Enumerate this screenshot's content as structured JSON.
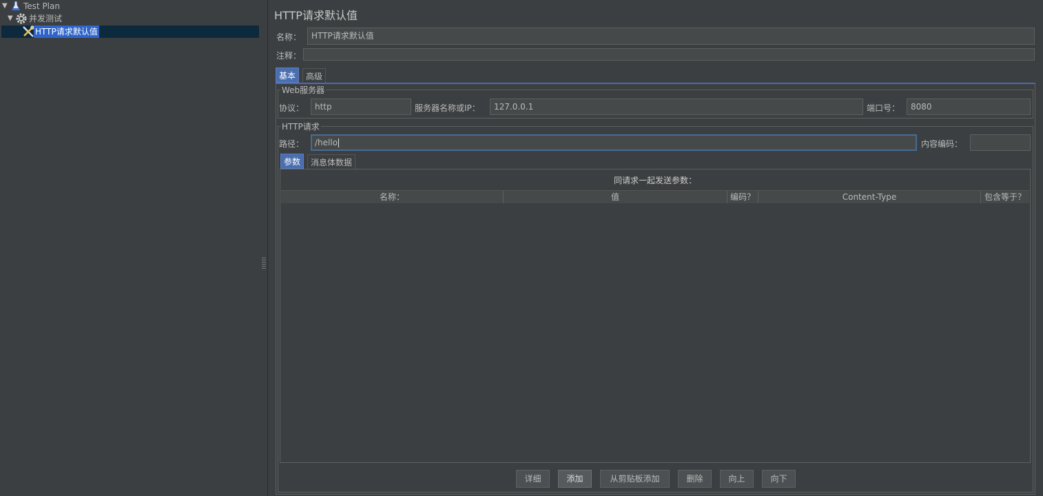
{
  "tree": {
    "items": [
      {
        "label": "Test Plan",
        "icon": "flask-icon",
        "expanded": true
      },
      {
        "label": "并发测试",
        "icon": "gear-icon",
        "expanded": true
      },
      {
        "label": "HTTP请求默认值",
        "icon": "tools-icon",
        "selected": true
      }
    ]
  },
  "panel": {
    "title": "HTTP请求默认值",
    "name_label": "名称：",
    "name_value": "HTTP请求默认值",
    "comment_label": "注释：",
    "comment_value": ""
  },
  "tabs": {
    "basic": "基本",
    "advanced": "高级"
  },
  "web_server": {
    "group_title": "Web服务器",
    "protocol_label": "协议：",
    "protocol_value": "http",
    "server_label": "服务器名称或IP：",
    "server_value": "127.0.0.1",
    "port_label": "端口号：",
    "port_value": "8080"
  },
  "http_request": {
    "group_title": "HTTP请求",
    "path_label": "路径：",
    "path_value": "/hello",
    "encoding_label": "内容编码：",
    "encoding_value": ""
  },
  "subtabs": {
    "params": "参数",
    "body": "消息体数据"
  },
  "params_table": {
    "caption": "同请求一起发送参数：",
    "columns": [
      "名称：",
      "值",
      "编码？",
      "Content-Type",
      "包含等于？"
    ]
  },
  "buttons": {
    "detail": "详细",
    "add": "添加",
    "add_from_clipboard": "从剪贴板添加",
    "delete": "删除",
    "up": "向上",
    "down": "向下"
  }
}
